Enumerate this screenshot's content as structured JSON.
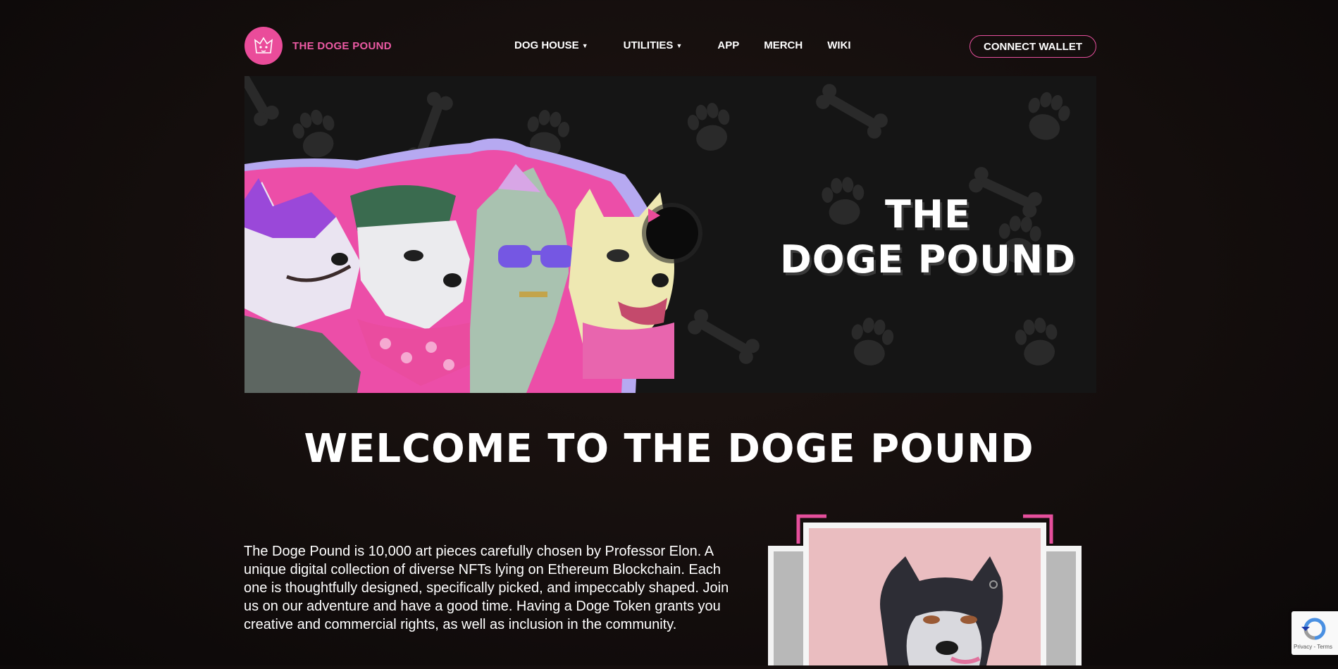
{
  "header": {
    "logo_text": "THE DOGE POUND",
    "nav": [
      {
        "label": "DOG HOUSE",
        "dropdown": true
      },
      {
        "label": "UTILITIES",
        "dropdown": true
      },
      {
        "label": "APP",
        "dropdown": false
      },
      {
        "label": "MERCH",
        "dropdown": false
      },
      {
        "label": "WIKI",
        "dropdown": false
      }
    ],
    "connect_label": "CONNECT WALLET"
  },
  "hero": {
    "title_line1": "THE",
    "title_line2": "DOGE POUND",
    "play_icon": "play-icon"
  },
  "welcome": {
    "heading": "WELCOME TO THE DOGE POUND",
    "description": "The Doge Pound is 10,000 art pieces carefully chosen by Professor Elon. A unique digital collection of diverse NFTs lying on Ethereum Blockchain. Each one is thoughtfully designed, specifically picked, and impeccably shaped. Join us on our adventure and have a good time. Having a Doge Token grants you creative and commercial rights, as well as inclusion in the community."
  },
  "recaptcha": {
    "terms": "Privacy - Terms"
  },
  "colors": {
    "accent": "#ea4c9a",
    "background": "#140e0d"
  }
}
